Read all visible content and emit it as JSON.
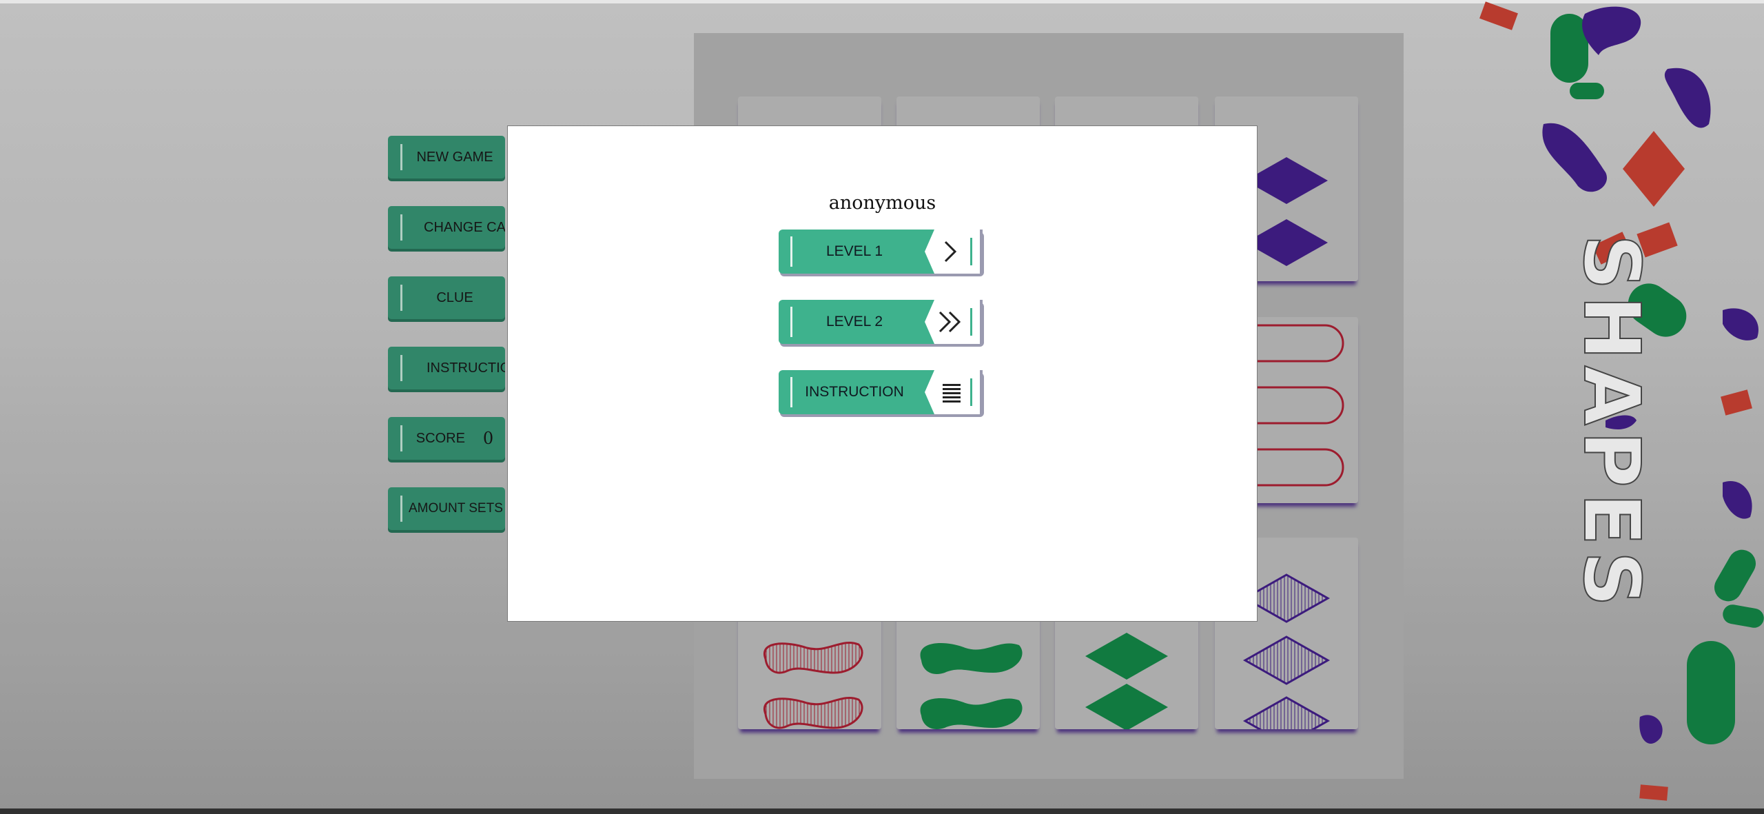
{
  "menu": {
    "new_game": "NEW GAME",
    "change_cards": "CHANGE CAR",
    "clue": "CLUE",
    "instruction": "INSTRUCTIO",
    "score_label": "SCORE",
    "score_value": "0",
    "amount_sets": "AMOUNT SETS"
  },
  "title_side": "SHAPES",
  "modal": {
    "username": "anonymous",
    "level1": "LEVEL 1",
    "level2": "LEVEL 2",
    "instruction": "INSTRUCTION"
  },
  "colors": {
    "menu_green": "#2e8a6b",
    "modal_green": "#3eb28d",
    "card_red": "#a3172b",
    "card_green": "#0b7d3e",
    "card_purple": "#3a1680"
  },
  "icons": {
    "level1": "single-chevron-right-icon",
    "level2": "double-chevron-right-icon",
    "instruction": "list-lines-icon"
  }
}
